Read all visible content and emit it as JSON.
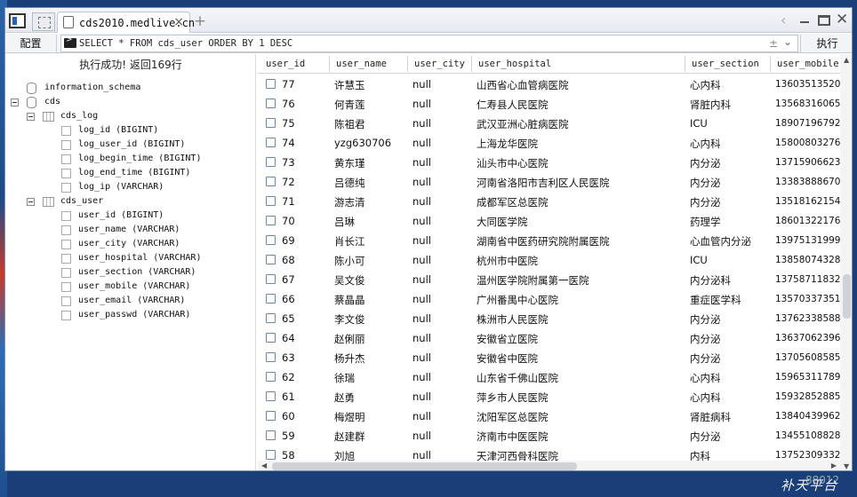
{
  "tab": {
    "title": "cds2010.medlive.cn",
    "close": "×",
    "new": "+"
  },
  "toolbar": {
    "config_label": "配置",
    "sql": "SELECT * FROM cds_user ORDER BY 1 DESC",
    "exec_label": "执行"
  },
  "status": "执行成功! 返回169行",
  "tree": [
    {
      "text": "information_schema",
      "kind": "db",
      "level": 0,
      "toggle": false
    },
    {
      "text": "cds",
      "kind": "db",
      "level": 0,
      "toggle": true
    },
    {
      "text": "cds_log",
      "kind": "table",
      "level": 1,
      "toggle": true
    },
    {
      "text": "log_id (BIGINT)",
      "kind": "column",
      "level": 2
    },
    {
      "text": "log_user_id (BIGINT)",
      "kind": "column",
      "level": 2
    },
    {
      "text": "log_begin_time (BIGINT)",
      "kind": "column",
      "level": 2
    },
    {
      "text": "log_end_time (BIGINT)",
      "kind": "column",
      "level": 2
    },
    {
      "text": "log_ip (VARCHAR)",
      "kind": "column",
      "level": 2
    },
    {
      "text": "cds_user",
      "kind": "table",
      "level": 1,
      "toggle": true
    },
    {
      "text": "user_id (BIGINT)",
      "kind": "column",
      "level": 2
    },
    {
      "text": "user_name (VARCHAR)",
      "kind": "column",
      "level": 2
    },
    {
      "text": "user_city (VARCHAR)",
      "kind": "column",
      "level": 2
    },
    {
      "text": "user_hospital (VARCHAR)",
      "kind": "column",
      "level": 2
    },
    {
      "text": "user_section (VARCHAR)",
      "kind": "column",
      "level": 2
    },
    {
      "text": "user_mobile (VARCHAR)",
      "kind": "column",
      "level": 2
    },
    {
      "text": "user_email (VARCHAR)",
      "kind": "column",
      "level": 2
    },
    {
      "text": "user_passwd (VARCHAR)",
      "kind": "column",
      "level": 2
    }
  ],
  "columns": [
    "user_id",
    "user_name",
    "user_city",
    "user_hospital",
    "user_section",
    "user_mobile"
  ],
  "rows": [
    [
      "77",
      "许慧玉",
      "null",
      "山西省心血管病医院",
      "心内科",
      "13603513520"
    ],
    [
      "76",
      "何青莲",
      "null",
      "仁寿县人民医院",
      "肾脏内科",
      "13568316065"
    ],
    [
      "75",
      "陈祖君",
      "null",
      "武汉亚洲心脏病医院",
      "ICU",
      "18907196792"
    ],
    [
      "74",
      "yzg630706",
      "null",
      "上海龙华医院",
      "心内科",
      "15800803276"
    ],
    [
      "73",
      "黄东瑾",
      "null",
      "汕头市中心医院",
      "内分泌",
      "13715906623"
    ],
    [
      "72",
      "吕德纯",
      "null",
      "河南省洛阳市吉利区人民医院",
      "内分泌",
      "13383888670"
    ],
    [
      "71",
      "游志清",
      "null",
      "成都军区总医院",
      "内分泌",
      "13518162154"
    ],
    [
      "70",
      "吕琳",
      "null",
      "大同医学院",
      "药理学",
      "18601322176"
    ],
    [
      "69",
      "肖长江",
      "null",
      "湖南省中医药研究院附属医院",
      "心血管内分泌",
      "13975131999"
    ],
    [
      "68",
      "陈小可",
      "null",
      "杭州市中医院",
      "ICU",
      "13858074328"
    ],
    [
      "67",
      "吴文俊",
      "null",
      "温州医学院附属第一医院",
      "内分泌科",
      "13758711832"
    ],
    [
      "66",
      "蔡晶晶",
      "null",
      "广州番禺中心医院",
      "重症医学科",
      "13570337351"
    ],
    [
      "65",
      "李文俊",
      "null",
      "株洲市人民医院",
      "内分泌",
      "13762338588"
    ],
    [
      "64",
      "赵俐丽",
      "null",
      "安徽省立医院",
      "内分泌",
      "13637062396"
    ],
    [
      "63",
      "杨升杰",
      "null",
      "安徽省中医院",
      "内分泌",
      "13705608585"
    ],
    [
      "62",
      "徐瑞",
      "null",
      "山东省千佛山医院",
      "心内科",
      "15965311789"
    ],
    [
      "61",
      "赵勇",
      "null",
      "萍乡市人民医院",
      "心内科",
      "15932852885"
    ],
    [
      "60",
      "梅煜明",
      "null",
      "沈阳军区总医院",
      "肾脏病科",
      "13840439962"
    ],
    [
      "59",
      "赵建群",
      "null",
      "济南市中医医院",
      "内分泌",
      "13455108828"
    ],
    [
      "58",
      "刘旭",
      "null",
      "天津河西骨科医院",
      "内科",
      "13752309332"
    ]
  ],
  "watermark": "补天平台",
  "watermark_sub": "88012"
}
